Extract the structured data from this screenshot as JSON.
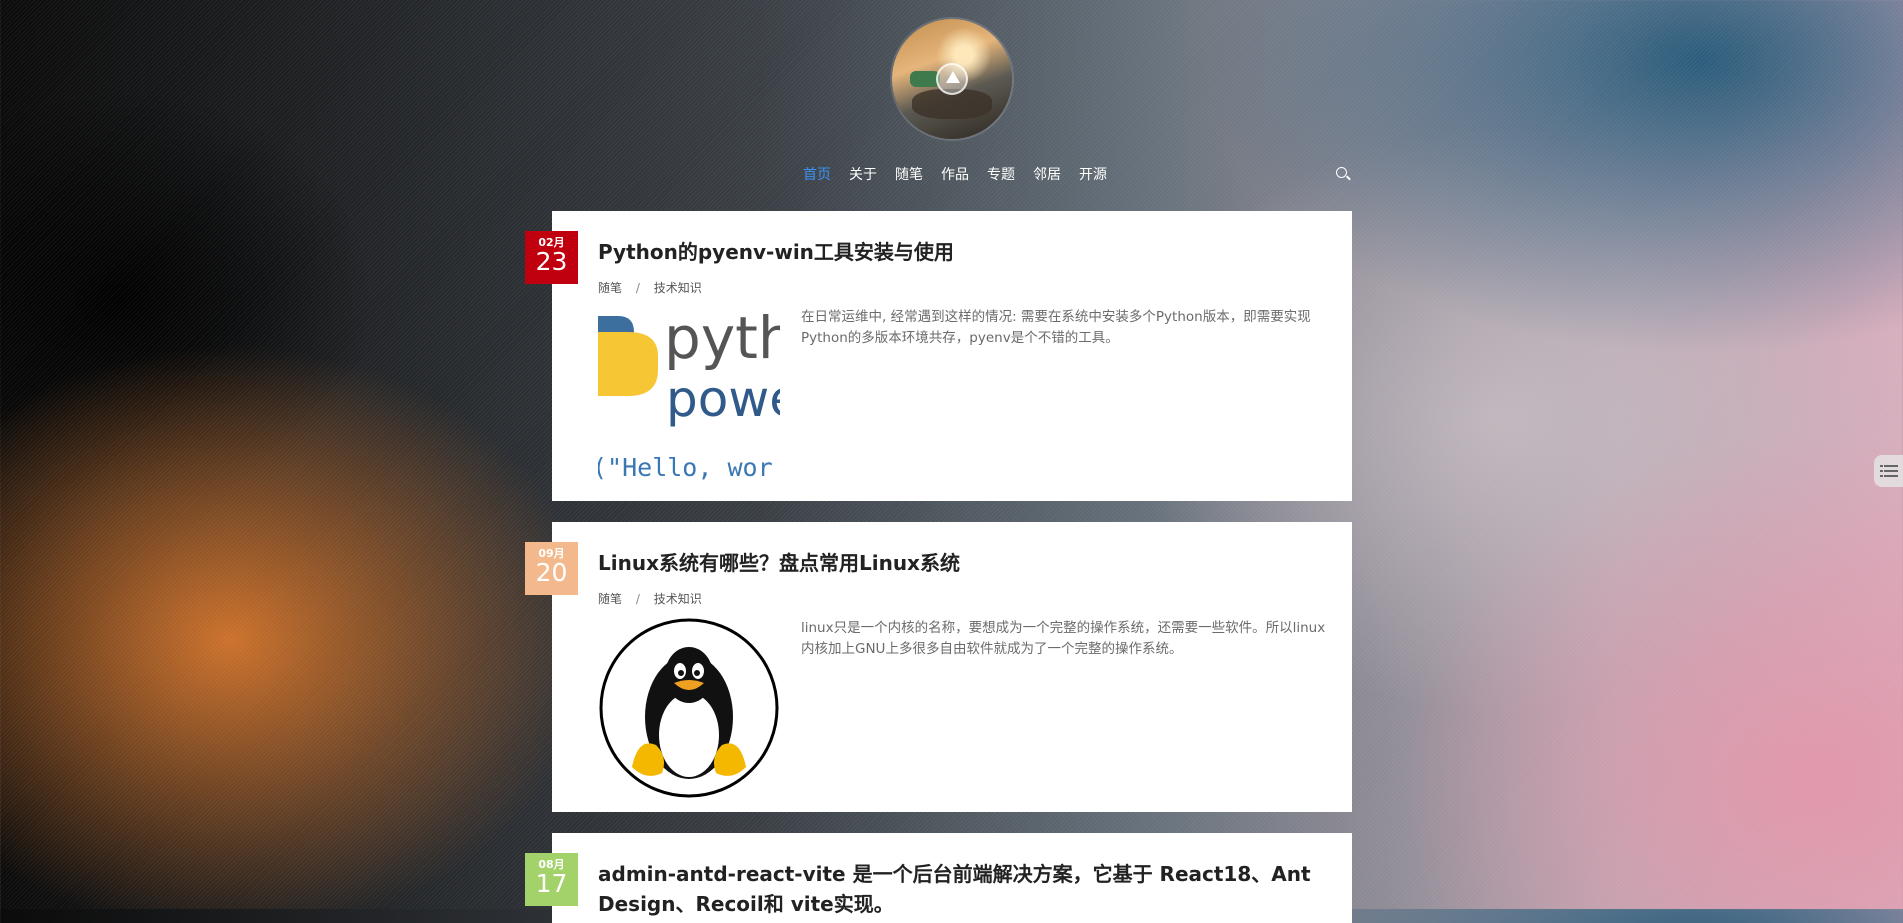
{
  "nav": {
    "items": [
      {
        "label": "首页",
        "active": true
      },
      {
        "label": "关于"
      },
      {
        "label": "随笔"
      },
      {
        "label": "作品"
      },
      {
        "label": "专题"
      },
      {
        "label": "邻居"
      },
      {
        "label": "开源"
      }
    ]
  },
  "posts": [
    {
      "month": "02月",
      "day": "23",
      "badge_color": "#c0000e",
      "title": "Python的pyenv-win工具安装与使用",
      "category": "随笔",
      "tag": "技术知识",
      "excerpt": "在日常运维中, 经常遇到这样的情况: 需要在系统中安装多个Python版本，即需要实现Python的多版本环境共存，pyenv是个不错的工具。",
      "thumb_text": {
        "line1": "pyth",
        "line2": "powe",
        "line3": "(\"Hello, wor"
      }
    },
    {
      "month": "09月",
      "day": "20",
      "badge_color": "#f3b98d",
      "title": "Linux系统有哪些？盘点常用Linux系统",
      "category": "随笔",
      "tag": "技术知识",
      "excerpt": "linux只是一个内核的名称，要想成为一个完整的操作系统，还需要一些软件。所以linux内核加上GNU上多很多自由软件就成为了一个完整的操作系统。"
    },
    {
      "month": "08月",
      "day": "17",
      "badge_color": "#a3d26b",
      "title": "admin-antd-react-vite 是一个后台前端解决方案，它基于 React18、Ant Design、Recoil和 vite实现。"
    }
  ]
}
